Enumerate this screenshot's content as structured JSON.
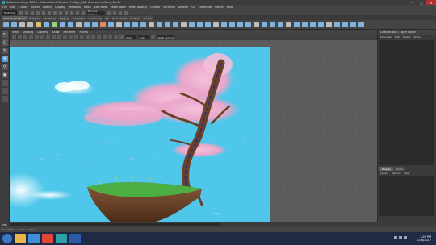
{
  "window": {
    "title": "Autodesk Maya 2016 - Educational Version: F:\\3ge_f\\3D Cheezetree\\tree_3.mb*"
  },
  "menubar": {
    "items": [
      "File",
      "Edit",
      "Create",
      "Select",
      "Modify",
      "Display",
      "Windows",
      "Mesh",
      "Edit Mesh",
      "Mesh Tools",
      "Mesh Display",
      "Curves",
      "Surfaces",
      "Deform",
      "UV",
      "Generate",
      "Cache",
      "Help"
    ]
  },
  "statusline": {
    "mode": "Modeling",
    "symmetry": "No Live Surface"
  },
  "shelf": {
    "tabs": [
      "Curves / Surfaces",
      "Polygons",
      "Sculpting",
      "Rigging",
      "Animation",
      "Rendering",
      "FX",
      "FX Caching",
      "Custom",
      "Arnold"
    ],
    "active_tab": "Curves / Surfaces",
    "icon_colors": [
      "#7fb3e0",
      "#7fb3e0",
      "#bdbdbd",
      "#bdbdbd",
      "#e0c070",
      "#7fb3e0",
      "#9bd07a",
      "#7fb3e0",
      "#7fb3e0",
      "#bdbdbd",
      "#7fb3e0",
      "#7fb3e0",
      "#e08a5a",
      "#7fb3e0",
      "#bdbdbd",
      "#7fb3e0",
      "#7fb3e0",
      "#7fb3e0",
      "#bdbdbd",
      "#7fb3e0",
      "#7fb3e0",
      "#7fb3e0",
      "#bdbdbd",
      "#7fb3e0",
      "#7fb3e0",
      "#7fb3e0",
      "#bdbdbd",
      "#7fb3e0",
      "#7fb3e0",
      "#7fb3e0",
      "#7fb3e0",
      "#bdbdbd",
      "#7fb3e0",
      "#7fb3e0",
      "#7fb3e0",
      "#bdbdbd",
      "#7fb3e0",
      "#7fb3e0",
      "#7fb3e0",
      "#7fb3e0",
      "#bdbdbd",
      "#7fb3e0",
      "#7fb3e0",
      "#7fb3e0",
      "#7fb3e0"
    ]
  },
  "panel": {
    "menu": [
      "View",
      "Shading",
      "Lighting",
      "Show",
      "Renderer",
      "Panels"
    ],
    "near_clip": "0.00",
    "far_clip": "1.00",
    "color_space": "sRGB gamma"
  },
  "viewport": {
    "camera_label": "persp"
  },
  "right_panel": {
    "title": "Channel Box / Layer Editor",
    "menu": [
      "Channels",
      "Edit",
      "Object",
      "Show"
    ],
    "layer_tabs": [
      "Display",
      "Anim"
    ],
    "active_layer_tab": "Display",
    "layer_menu": [
      "Layers",
      "Options",
      "Help"
    ]
  },
  "cmdline": {
    "language": "MEL"
  },
  "helpline": {
    "text": "Select Tool: select an object"
  },
  "taskbar": {
    "apps": [
      {
        "name": "file-explorer",
        "color": "#e8b64a"
      },
      {
        "name": "media-player",
        "color": "#3d8fd8"
      },
      {
        "name": "chrome",
        "color": "#e0463a"
      },
      {
        "name": "maya",
        "color": "#2aa0a8"
      },
      {
        "name": "photoshop",
        "color": "#2a5aa8"
      }
    ],
    "time": "3:20 PM",
    "date": "1/16/2017"
  },
  "colors": {
    "sky": "#4fc7ea",
    "blossom": "#f0b6d4",
    "bark": "#6b4228",
    "grass": "#4caf43",
    "rock": "#7a4e30"
  }
}
